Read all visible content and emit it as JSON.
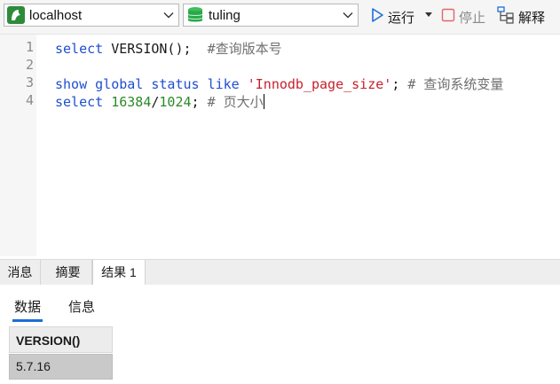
{
  "toolbar": {
    "connection": "localhost",
    "database": "tuling",
    "run_label": "运行",
    "stop_label": "停止",
    "explain_label": "解释",
    "colors": {
      "run": "#1d6fd6",
      "stop": "#e06767",
      "connection": "#2e8b3a",
      "database": "#2aa84a"
    }
  },
  "editor": {
    "lines": [
      {
        "number": "1",
        "tokens": [
          {
            "text": "select",
            "type": "kw"
          },
          {
            "text": " VERSION();  ",
            "type": "plain"
          },
          {
            "text": "#查询版本号",
            "type": "cm"
          }
        ]
      },
      {
        "number": "2",
        "tokens": []
      },
      {
        "number": "3",
        "tokens": [
          {
            "text": "show",
            "type": "kw"
          },
          {
            "text": " ",
            "type": "plain"
          },
          {
            "text": "global",
            "type": "kw"
          },
          {
            "text": " ",
            "type": "plain"
          },
          {
            "text": "status",
            "type": "kw"
          },
          {
            "text": " ",
            "type": "plain"
          },
          {
            "text": "like",
            "type": "kw"
          },
          {
            "text": " ",
            "type": "plain"
          },
          {
            "text": "'Innodb_page_size'",
            "type": "str"
          },
          {
            "text": "; ",
            "type": "plain"
          },
          {
            "text": "# 查询系统变量",
            "type": "cm"
          }
        ]
      },
      {
        "number": "4",
        "tokens": [
          {
            "text": "select",
            "type": "kw"
          },
          {
            "text": " ",
            "type": "plain"
          },
          {
            "text": "16384",
            "type": "num"
          },
          {
            "text": "/",
            "type": "plain"
          },
          {
            "text": "1024",
            "type": "num"
          },
          {
            "text": "; ",
            "type": "plain"
          },
          {
            "text": "# 页大小",
            "type": "cm"
          }
        ]
      }
    ]
  },
  "panel": {
    "tabs": [
      {
        "label": "消息",
        "active": false
      },
      {
        "label": "摘要",
        "active": false
      },
      {
        "label": "结果 1",
        "active": true
      }
    ],
    "subtabs": [
      {
        "label": "数据",
        "active": true
      },
      {
        "label": "信息",
        "active": false
      }
    ],
    "grid": {
      "columns": [
        "VERSION()"
      ],
      "rows": [
        [
          "5.7.16"
        ]
      ]
    }
  }
}
